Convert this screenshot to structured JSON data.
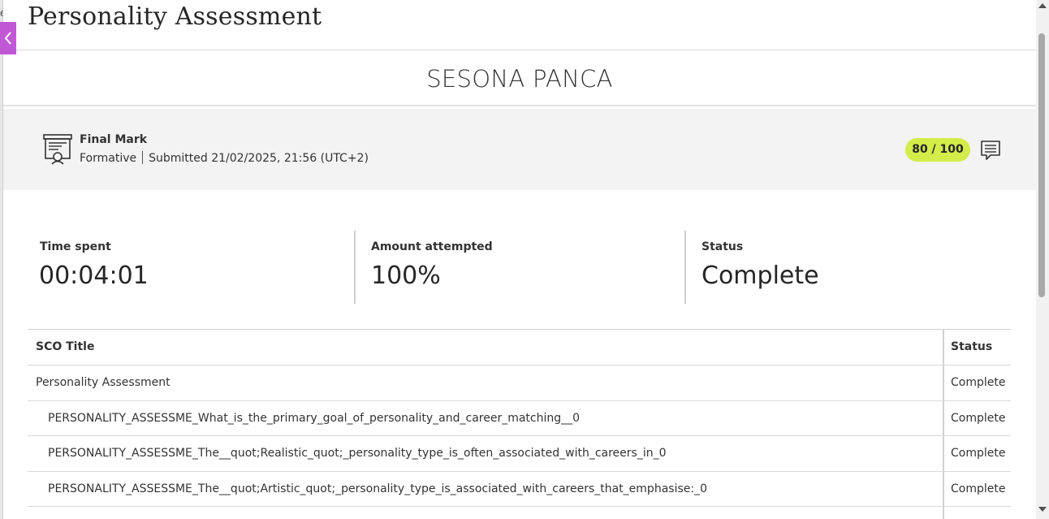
{
  "window": {
    "title": "Personality Assessment",
    "left_fragment": "e"
  },
  "student": {
    "name": "SESONA PANCA"
  },
  "final_mark": {
    "icon": "certificate-icon",
    "title": "Final Mark",
    "type": "Formative",
    "submitted": "Submitted 21/02/2025, 21:56 (UTC+2)",
    "score": "80 / 100",
    "score_color": "#d4ec4a",
    "comment_icon": "comment-icon"
  },
  "stats": [
    {
      "label": "Time spent",
      "value": "00:04:01"
    },
    {
      "label": "Amount attempted",
      "value": "100%"
    },
    {
      "label": "Status",
      "value": "Complete"
    }
  ],
  "table": {
    "headers": [
      "SCO Title",
      "Status"
    ],
    "rows": [
      {
        "title": "Personality Assessment",
        "status": "Complete"
      },
      {
        "title": "PERSONALITY_ASSESSME_What_is_the_primary_goal_of_personality_and_career_matching__0",
        "status": "Complete"
      },
      {
        "title": "PERSONALITY_ASSESSME_The__quot;Realistic_quot;_personality_type_is_often_associated_with_careers_in_0",
        "status": "Complete"
      },
      {
        "title": "PERSONALITY_ASSESSME_The__quot;Artistic_quot;_personality_type_is_associated_with_careers_that_emphasise:_0",
        "status": "Complete"
      }
    ]
  },
  "accent_color": "#c058d6"
}
